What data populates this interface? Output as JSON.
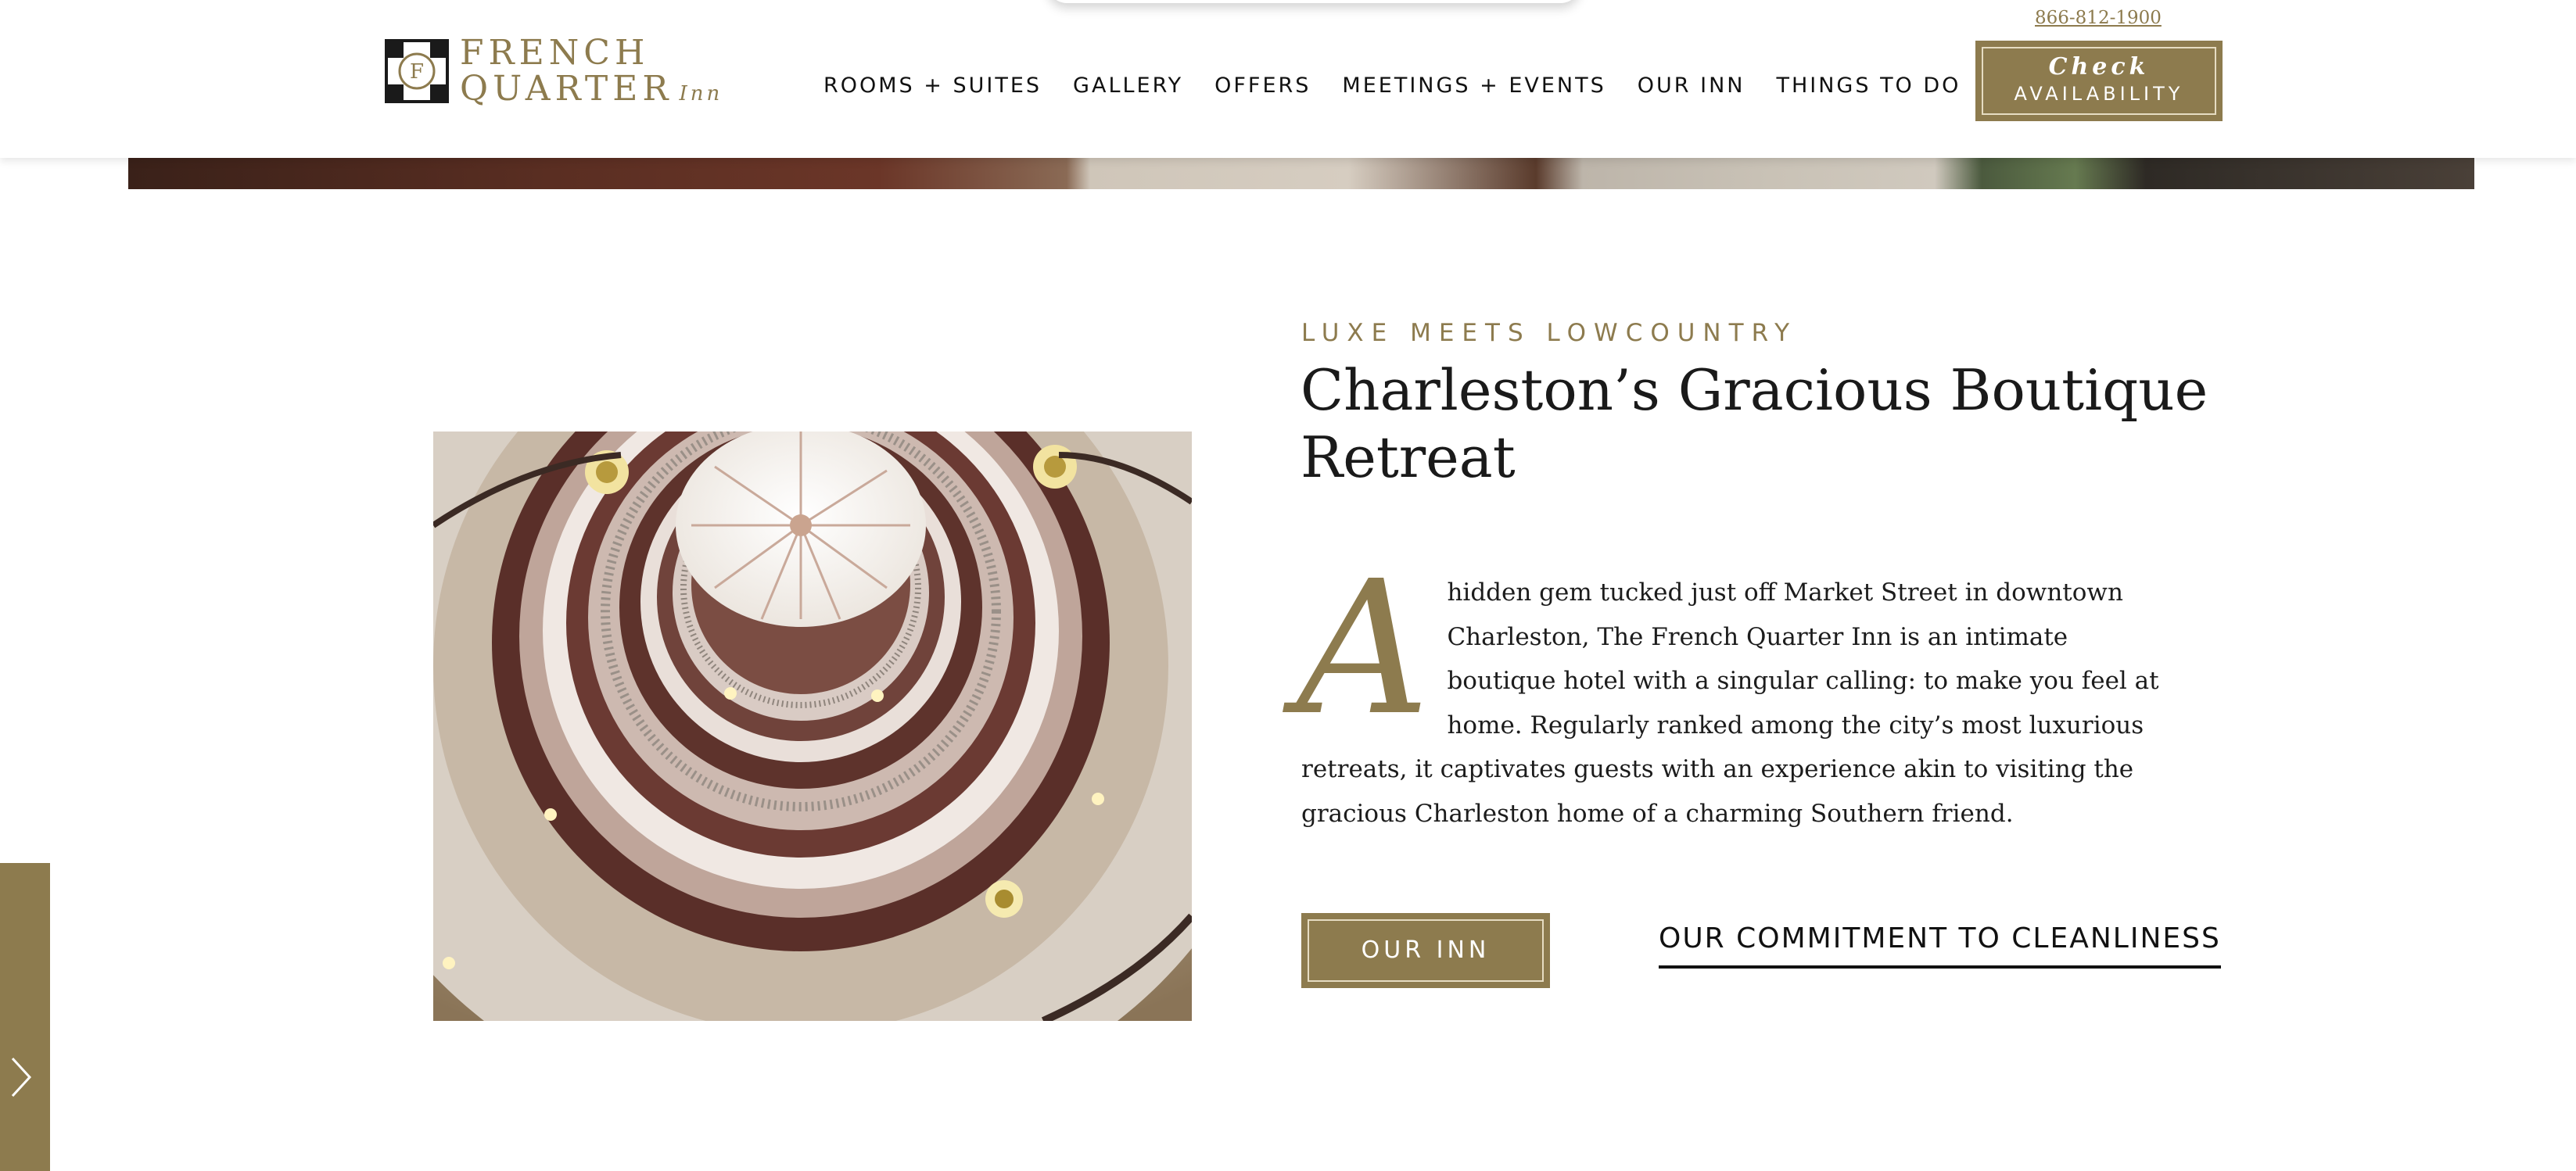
{
  "brand": {
    "name_line1": "FRENCH",
    "name_line2": "QUARTER",
    "name_suffix": "Inn",
    "logo_icon": "monogram-f-icon"
  },
  "header": {
    "phone": "866-812-1900",
    "check_availability": {
      "line1": "Check",
      "line2": "AVAILABILITY"
    }
  },
  "nav": {
    "items": [
      {
        "label": "ROOMS + SUITES"
      },
      {
        "label": "GALLERY"
      },
      {
        "label": "OFFERS"
      },
      {
        "label": "MEETINGS + EVENTS"
      },
      {
        "label": "OUR INN"
      },
      {
        "label": "THINGS TO DO"
      }
    ]
  },
  "intro": {
    "eyebrow": "LUXE MEETS LOWCOUNTRY",
    "title": "Charleston’s Gracious Boutique Retreat",
    "drop_cap": "A",
    "body": "hidden gem tucked just off Market Street in downtown Charleston, The French Quarter Inn is an intimate boutique hotel with a singular calling: to make you feel at home. Regularly ranked among the city’s most luxurious retreats, it captivates guests with an experience akin to visiting the gracious Charleston home of a charming Southern friend.",
    "primary_button": "OUR INN",
    "secondary_link": "OUR COMMITMENT TO CLEANLINESS",
    "image": "spiral-staircase-photo"
  },
  "side_tab": {
    "icon": "chevron-right-icon"
  },
  "colors": {
    "accent": "#8d7b4e",
    "text": "#1a1a1a",
    "background": "#ffffff"
  }
}
